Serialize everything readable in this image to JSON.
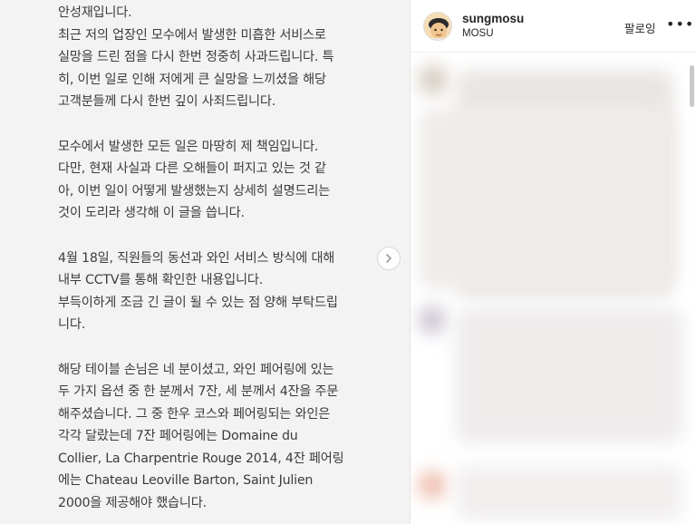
{
  "post": {
    "paragraphs": [
      [
        "안성재입니다.",
        "최근 저의 업장인 모수에서 발생한 미흡한 서비스로",
        "실망을 드린 점을 다시 한번 정중히 사과드립니다. 특",
        "히, 이번 일로 인해 저에게 큰 실망을 느끼셨을 해당",
        "고객분들께 다시 한번 깊이 사죄드립니다."
      ],
      [
        "모수에서 발생한 모든 일은 마땅히 제 책임입니다.",
        "다만, 현재 사실과 다른 오해들이 퍼지고 있는 것 같",
        "아, 이번 일이 어떻게 발생했는지 상세히 설명드리는",
        "것이 도리라 생각해 이 글을 씁니다."
      ],
      [
        "4월 18일, 직원들의 동선과 와인 서비스 방식에 대해",
        "내부 CCTV를 통해 확인한 내용입니다.",
        "부득이하게 조금 긴 글이 될 수 있는 점 양해 부탁드립",
        "니다."
      ],
      [
        "해당 테이블 손님은 네 분이셨고, 와인 페어링에 있는",
        "두 가지 옵션 중 한 분께서 7잔, 세 분께서 4잔을 주문",
        "해주셨습니다. 그 중 한우 코스와 페어링되는 와인은",
        "각각 달랐는데 7잔 페어링에는 Domaine du",
        "Collier, La Charpentrie Rouge 2014, 4잔 페어링",
        "에는 Chateau Leoville Barton, Saint Julien",
        "2000을 제공해야 했습니다."
      ]
    ]
  },
  "header": {
    "username": "sungmosu",
    "subtitle": "MOSU",
    "follow_label": "팔로잉",
    "more_label": "•••"
  },
  "icons": {
    "next": "chevron-right-icon",
    "avatar": "profile-avatar"
  }
}
